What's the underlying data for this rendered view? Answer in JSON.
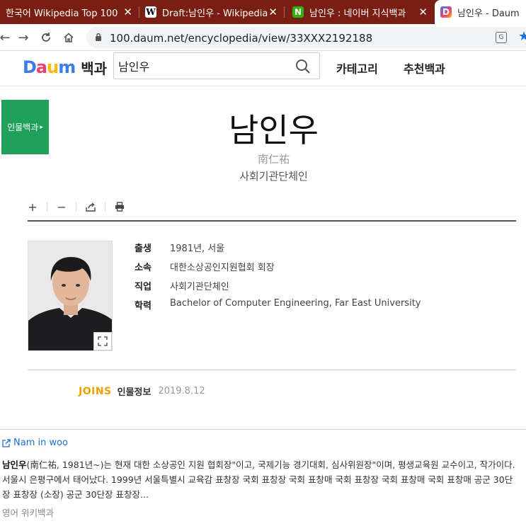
{
  "browser": {
    "tabs": [
      {
        "title": "한국어 Wikipedia Top 100",
        "favicon": ""
      },
      {
        "title": "Draft:남인우 - Wikipedia",
        "favicon": "W"
      },
      {
        "title": "남인우 : 네이버 지식백과",
        "favicon": "N"
      },
      {
        "title": "남인우 - Daum",
        "favicon": "D"
      }
    ],
    "url": "100.daum.net/encyclopedia/view/33XXX2192188"
  },
  "header": {
    "logo": {
      "d": "D",
      "a": "a",
      "u": "u",
      "m": "m",
      "section": "백과"
    },
    "search_value": "남인우",
    "nav": [
      "카테고리",
      "추천백과"
    ]
  },
  "article": {
    "category_badge": "인물백과",
    "title": "남인우",
    "hanja": "南仁祐",
    "subcategory": "사회기관단체인",
    "info": [
      {
        "key": "출생",
        "value": "1981년, 서울"
      },
      {
        "key": "소속",
        "value": "대한소상공인지원협회 회장"
      },
      {
        "key": "직업",
        "value": "사회기관단체인"
      },
      {
        "key": "학력",
        "value": "Bachelor of Computer Engineering, Far East University"
      }
    ],
    "source": {
      "brand": "JOINS",
      "label": "인물정보",
      "date": "2019.8.12"
    }
  },
  "related": {
    "link": "Nam in woo",
    "summary_name": "남인우",
    "summary_rest": "(南仁祐, 1981년~)는 현재 대한 소상공인 지원 협회장\"이고, 국제기능 경기대회, 심사위원장\"이며, 평생교육원 교수이고, 작가이다. 서울시 은평구에서 태어났다. 1999년 서울특별시 교육감 표창장 국회 표창장 국회 표창매 국회 표창장 국회 표창매 국회 표창매 공군 30단장 표창장 (소장) 공군 30단장 표창장...",
    "source": "영어 위키백과"
  },
  "colors": {
    "tabstrip": "#7a1d12",
    "badge": "#1fa05b",
    "link": "#1a6fd0",
    "joins": "#f0a000"
  }
}
